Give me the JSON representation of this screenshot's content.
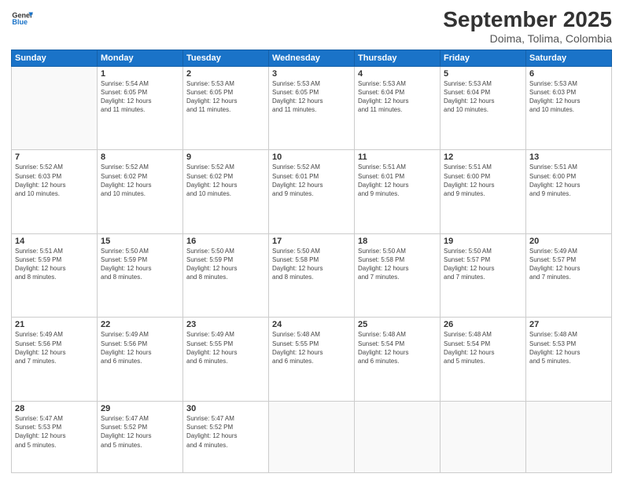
{
  "logo": {
    "line1": "General",
    "line2": "Blue",
    "icon_color": "#1a73c8"
  },
  "title": "September 2025",
  "subtitle": "Doima, Tolima, Colombia",
  "days_of_week": [
    "Sunday",
    "Monday",
    "Tuesday",
    "Wednesday",
    "Thursday",
    "Friday",
    "Saturday"
  ],
  "weeks": [
    [
      {
        "day": "",
        "info": ""
      },
      {
        "day": "1",
        "info": "Sunrise: 5:54 AM\nSunset: 6:05 PM\nDaylight: 12 hours\nand 11 minutes."
      },
      {
        "day": "2",
        "info": "Sunrise: 5:53 AM\nSunset: 6:05 PM\nDaylight: 12 hours\nand 11 minutes."
      },
      {
        "day": "3",
        "info": "Sunrise: 5:53 AM\nSunset: 6:05 PM\nDaylight: 12 hours\nand 11 minutes."
      },
      {
        "day": "4",
        "info": "Sunrise: 5:53 AM\nSunset: 6:04 PM\nDaylight: 12 hours\nand 11 minutes."
      },
      {
        "day": "5",
        "info": "Sunrise: 5:53 AM\nSunset: 6:04 PM\nDaylight: 12 hours\nand 10 minutes."
      },
      {
        "day": "6",
        "info": "Sunrise: 5:53 AM\nSunset: 6:03 PM\nDaylight: 12 hours\nand 10 minutes."
      }
    ],
    [
      {
        "day": "7",
        "info": "Sunrise: 5:52 AM\nSunset: 6:03 PM\nDaylight: 12 hours\nand 10 minutes."
      },
      {
        "day": "8",
        "info": "Sunrise: 5:52 AM\nSunset: 6:02 PM\nDaylight: 12 hours\nand 10 minutes."
      },
      {
        "day": "9",
        "info": "Sunrise: 5:52 AM\nSunset: 6:02 PM\nDaylight: 12 hours\nand 10 minutes."
      },
      {
        "day": "10",
        "info": "Sunrise: 5:52 AM\nSunset: 6:01 PM\nDaylight: 12 hours\nand 9 minutes."
      },
      {
        "day": "11",
        "info": "Sunrise: 5:51 AM\nSunset: 6:01 PM\nDaylight: 12 hours\nand 9 minutes."
      },
      {
        "day": "12",
        "info": "Sunrise: 5:51 AM\nSunset: 6:00 PM\nDaylight: 12 hours\nand 9 minutes."
      },
      {
        "day": "13",
        "info": "Sunrise: 5:51 AM\nSunset: 6:00 PM\nDaylight: 12 hours\nand 9 minutes."
      }
    ],
    [
      {
        "day": "14",
        "info": "Sunrise: 5:51 AM\nSunset: 5:59 PM\nDaylight: 12 hours\nand 8 minutes."
      },
      {
        "day": "15",
        "info": "Sunrise: 5:50 AM\nSunset: 5:59 PM\nDaylight: 12 hours\nand 8 minutes."
      },
      {
        "day": "16",
        "info": "Sunrise: 5:50 AM\nSunset: 5:59 PM\nDaylight: 12 hours\nand 8 minutes."
      },
      {
        "day": "17",
        "info": "Sunrise: 5:50 AM\nSunset: 5:58 PM\nDaylight: 12 hours\nand 8 minutes."
      },
      {
        "day": "18",
        "info": "Sunrise: 5:50 AM\nSunset: 5:58 PM\nDaylight: 12 hours\nand 7 minutes."
      },
      {
        "day": "19",
        "info": "Sunrise: 5:50 AM\nSunset: 5:57 PM\nDaylight: 12 hours\nand 7 minutes."
      },
      {
        "day": "20",
        "info": "Sunrise: 5:49 AM\nSunset: 5:57 PM\nDaylight: 12 hours\nand 7 minutes."
      }
    ],
    [
      {
        "day": "21",
        "info": "Sunrise: 5:49 AM\nSunset: 5:56 PM\nDaylight: 12 hours\nand 7 minutes."
      },
      {
        "day": "22",
        "info": "Sunrise: 5:49 AM\nSunset: 5:56 PM\nDaylight: 12 hours\nand 6 minutes."
      },
      {
        "day": "23",
        "info": "Sunrise: 5:49 AM\nSunset: 5:55 PM\nDaylight: 12 hours\nand 6 minutes."
      },
      {
        "day": "24",
        "info": "Sunrise: 5:48 AM\nSunset: 5:55 PM\nDaylight: 12 hours\nand 6 minutes."
      },
      {
        "day": "25",
        "info": "Sunrise: 5:48 AM\nSunset: 5:54 PM\nDaylight: 12 hours\nand 6 minutes."
      },
      {
        "day": "26",
        "info": "Sunrise: 5:48 AM\nSunset: 5:54 PM\nDaylight: 12 hours\nand 5 minutes."
      },
      {
        "day": "27",
        "info": "Sunrise: 5:48 AM\nSunset: 5:53 PM\nDaylight: 12 hours\nand 5 minutes."
      }
    ],
    [
      {
        "day": "28",
        "info": "Sunrise: 5:47 AM\nSunset: 5:53 PM\nDaylight: 12 hours\nand 5 minutes."
      },
      {
        "day": "29",
        "info": "Sunrise: 5:47 AM\nSunset: 5:52 PM\nDaylight: 12 hours\nand 5 minutes."
      },
      {
        "day": "30",
        "info": "Sunrise: 5:47 AM\nSunset: 5:52 PM\nDaylight: 12 hours\nand 4 minutes."
      },
      {
        "day": "",
        "info": ""
      },
      {
        "day": "",
        "info": ""
      },
      {
        "day": "",
        "info": ""
      },
      {
        "day": "",
        "info": ""
      }
    ]
  ]
}
